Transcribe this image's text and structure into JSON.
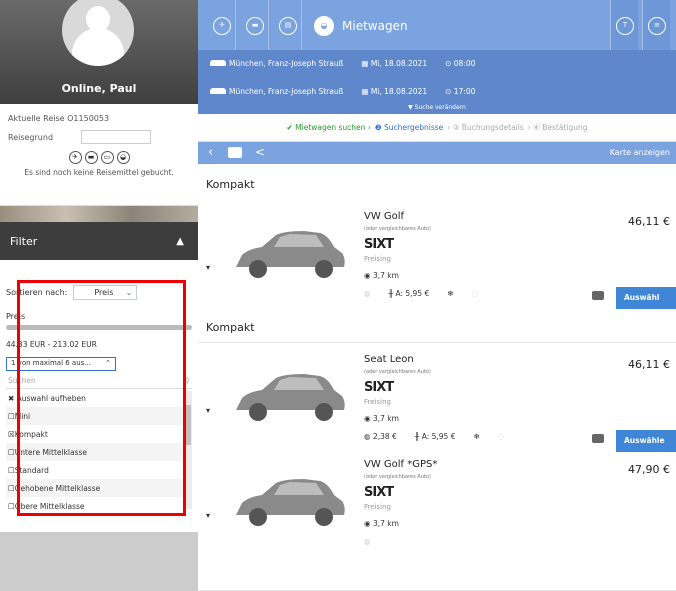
{
  "sidebar": {
    "user_name": "Online, Paul",
    "trip_label": "Aktuelle Reise O1150053",
    "reisegrund_label": "Reisegrund",
    "no_mittel": "Es sind noch keine Reisemittel gebucht.",
    "filter_title": "Filter",
    "sort_label": "Sortieren nach:",
    "sort_value": "Preis",
    "preis_label": "Preis",
    "preis_range": "44.33 EUR - 213.02 EUR",
    "class_dropdown": "1 von maximal 6 aus...",
    "class_search_placeholder": "Suchen",
    "clear_selection": "Auswahl aufheben",
    "classes": [
      {
        "label": "Mini",
        "checked": false
      },
      {
        "label": "Kompakt",
        "checked": true
      },
      {
        "label": "Untere Mittelklasse",
        "checked": false
      },
      {
        "label": "Standard",
        "checked": false
      },
      {
        "label": "Gehobene Mittelklasse",
        "checked": false
      },
      {
        "label": "Obere Mittelklasse",
        "checked": false
      }
    ]
  },
  "header": {
    "active_tab": "Mietwagen",
    "pickup": {
      "location": "München, Franz-Joseph Strauß",
      "date": "Mi, 18.08.2021",
      "time": "08:00"
    },
    "dropoff": {
      "location": "München, Franz-Joseph Strauß",
      "date": "Mi, 18.08.2021",
      "time": "17:00"
    },
    "change_search": "▼ Suche verändern",
    "steps": [
      "Mietwagen suchen",
      "Suchergebnisse",
      "Buchungsdetails",
      "Bestätigung"
    ],
    "map_label": "Karte anzeigen"
  },
  "results": [
    {
      "section": "Kompakt",
      "name": "VW Golf",
      "sub": "(oder vergleichbares Auto)",
      "vendor": "SIXT",
      "city": "Freising",
      "dist": "3,7 km",
      "fee": "",
      "ac": "A: 5,95 €",
      "price": "46,11 €",
      "select": "Auswähl"
    },
    {
      "section": "Kompakt",
      "name": "Seat Leon",
      "sub": "(oder vergleichbares Auto)",
      "vendor": "SIXT",
      "city": "Freising",
      "dist": "3,7 km",
      "fee": "2,38 €",
      "ac": "A: 5,95 €",
      "price": "46,11 €",
      "select": "Auswähle"
    },
    {
      "section": "",
      "name": "VW Golf *GPS*",
      "sub": "(oder vergleichbares Auto)",
      "vendor": "SIXT",
      "city": "Freising",
      "dist": "3,7 km",
      "fee": "",
      "ac": "",
      "price": "47,90 €",
      "select": ""
    }
  ]
}
